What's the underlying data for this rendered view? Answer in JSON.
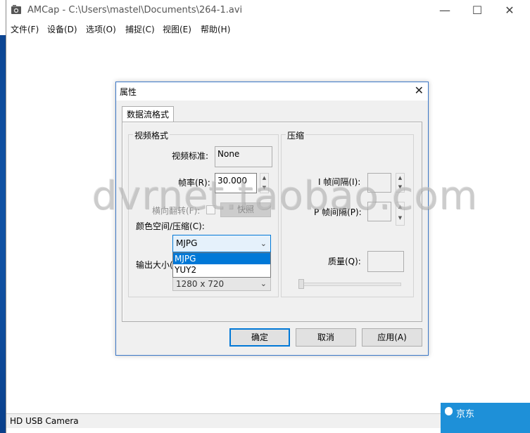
{
  "window": {
    "title": "AMCap - C:\\Users\\mastel\\Documents\\264-1.avi",
    "minimize_glyph": "—",
    "maximize_glyph": "☐",
    "close_glyph": "✕"
  },
  "menu": [
    "文件(F)",
    "设备(D)",
    "选项(O)",
    "捕捉(C)",
    "视图(E)",
    "帮助(H)"
  ],
  "status": {
    "device": "HD USB Camera"
  },
  "dialog": {
    "title": "属性",
    "close_glyph": "✕",
    "tab": "数据流格式",
    "video_format": {
      "group_label": "视频格式",
      "video_standard_label": "视频标准:",
      "video_standard_value": "None",
      "frame_rate_label": "帧率(R):",
      "frame_rate_value": "30.000",
      "flip_label": "横向翻转(F):",
      "snapshot_button": "快照",
      "color_space_label": "颜色空间/压缩(C):",
      "color_space_selected": "MJPG",
      "color_space_options": [
        "MJPG",
        "YUY2"
      ],
      "output_size_label": "输出大小(",
      "output_size_value": "1280 x 720"
    },
    "compression": {
      "group_label": "压缩",
      "i_frame_label": "I 帧间隔(I):",
      "p_frame_label": "P 帧间隔(P):",
      "quality_label": "质量(Q):"
    },
    "buttons": {
      "ok": "确定",
      "cancel": "取消",
      "apply": "应用(A)"
    }
  },
  "watermark": "dvrnet.taobao.com",
  "notification": {
    "label": "京东"
  },
  "colors": {
    "accent": "#0078d7",
    "desktop": "#1561b8"
  }
}
